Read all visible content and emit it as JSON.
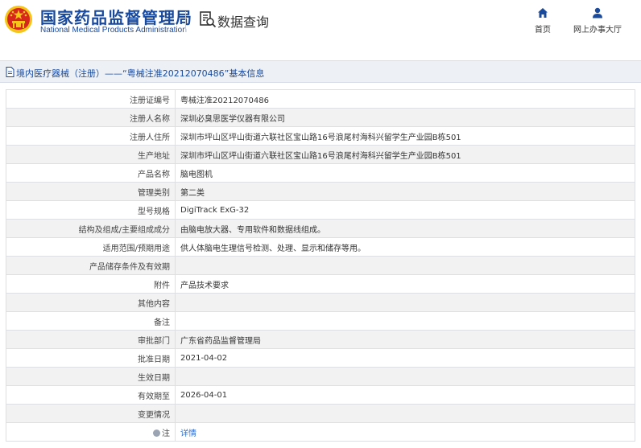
{
  "header": {
    "org_name_cn": "国家药品监督管理局",
    "org_name_en": "National Medical Products Administration",
    "section_title": "数据查询",
    "nav": [
      {
        "label": "首页",
        "icon": "home-icon"
      },
      {
        "label": "网上办事大厅",
        "icon": "user-icon"
      }
    ]
  },
  "title_bar": {
    "text": "境内医疗器械（注册）——“粤械注准20212070486”基本信息"
  },
  "rows": [
    {
      "label": "注册证编号",
      "value": "粤械注准20212070486"
    },
    {
      "label": "注册人名称",
      "value": "深圳必臭思医学仪器有限公司"
    },
    {
      "label": "注册人住所",
      "value": "深圳市坪山区坪山街道六联社区宝山路16号浪尾村海科兴留学生产业园B栋501"
    },
    {
      "label": "生产地址",
      "value": "深圳市坪山区坪山街道六联社区宝山路16号浪尾村海科兴留学生产业园B栋501"
    },
    {
      "label": "产品名称",
      "value": "脑电图机"
    },
    {
      "label": "管理类别",
      "value": "第二类"
    },
    {
      "label": "型号规格",
      "value": "DigiTrack ExG-32"
    },
    {
      "label": "结构及组成/主要组成成分",
      "value": "由脑电放大器、专用软件和数据线组成。"
    },
    {
      "label": "适用范围/预期用途",
      "value": "供人体脑电生理信号检测、处理、显示和储存等用。"
    },
    {
      "label": "产品储存条件及有效期",
      "value": ""
    },
    {
      "label": "附件",
      "value": "产品技术要求"
    },
    {
      "label": "其他内容",
      "value": ""
    },
    {
      "label": "备注",
      "value": ""
    },
    {
      "label": "审批部门",
      "value": "广东省药品监督管理局"
    },
    {
      "label": "批准日期",
      "value": "2021-04-02"
    },
    {
      "label": "生效日期",
      "value": ""
    },
    {
      "label": "有效期至",
      "value": "2026-04-01"
    },
    {
      "label": "变更情况",
      "value": ""
    },
    {
      "label": "注",
      "value": "详情",
      "icon": "info-icon",
      "link": true
    }
  ],
  "colors": {
    "brand_blue": "#1a4a9c",
    "link_blue": "#2a6fcf",
    "emblem_red": "#d7261e",
    "emblem_gold": "#f5c518"
  }
}
